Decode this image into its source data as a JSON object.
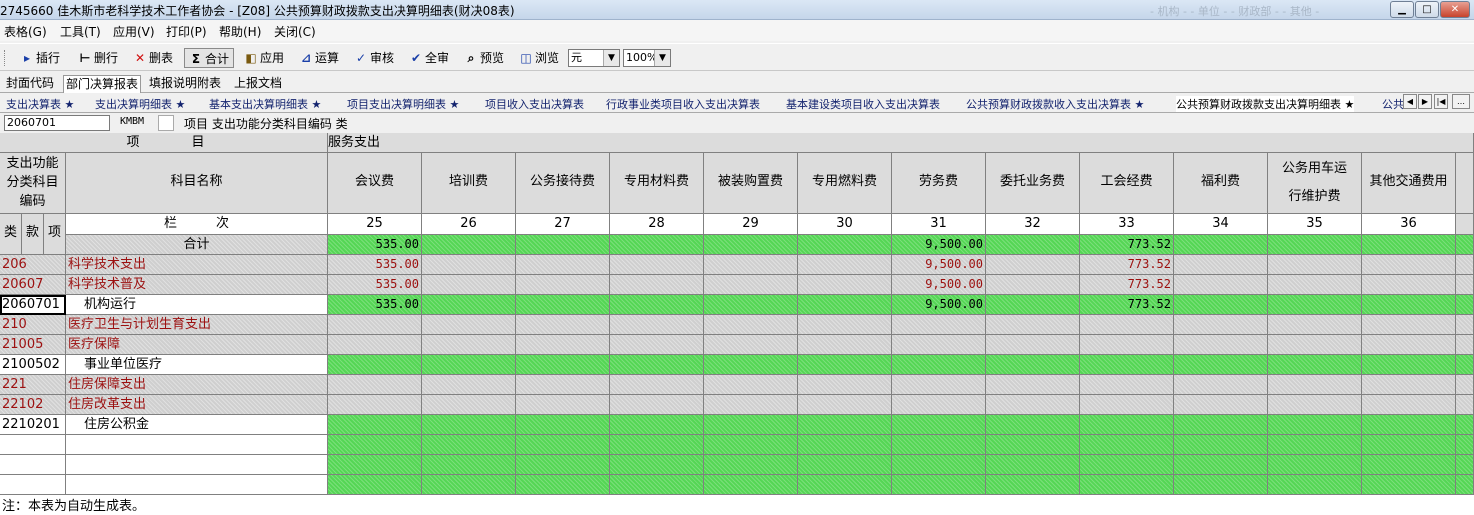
{
  "window": {
    "title": "2745660  佳木斯市老科学技术工作者协会 - [Z08] 公共预算财政拨款支出决算明细表(财决08表)",
    "blurred_text": "- 机构 -     - 单位 -    - 财政部 -    - 其他 -"
  },
  "menu": [
    "表格(G)",
    "工具(T)",
    "应用(V)",
    "打印(P)",
    "帮助(H)",
    "关闭(C)"
  ],
  "toolbar": {
    "insert_row": "插行",
    "delete_row": "删行",
    "delete_table": "删表",
    "total": "合计",
    "apply": "应用",
    "calculate": "运算",
    "audit": "审核",
    "audit_all": "全审",
    "preview": "预览",
    "browse": "浏览",
    "unit_value": "元",
    "zoom_value": "100%"
  },
  "tabs_main": [
    "封面代码",
    "部门决算报表",
    "填报说明附表",
    "上报文档"
  ],
  "tabs_sub": [
    "支出决算表 ★",
    "支出决算明细表 ★",
    "基本支出决算明细表 ★",
    "项目支出决算明细表 ★",
    "项目收入支出决算表",
    "行政事业类项目收入支出决算表",
    "基本建设类项目收入支出决算表",
    "公共预算财政拨款收入支出决算表 ★",
    "公共预算财政拨款支出决算明细表 ★",
    "公共"
  ],
  "input_bar": {
    "code_value": "2060701",
    "field_code": "KMBM",
    "hint": "项目  支出功能分类科目编码 类"
  },
  "table": {
    "header_project": "项　　　　目",
    "header_group": "服务支出",
    "header_code": "支出功能分类科目编码",
    "header_name": "科目名称",
    "header_lanci": "栏　　　次",
    "sub_headers": [
      "类",
      "款",
      "项"
    ],
    "columns": [
      {
        "name": "会议费",
        "no": "25"
      },
      {
        "name": "培训费",
        "no": "26"
      },
      {
        "name": "公务接待费",
        "no": "27"
      },
      {
        "name": "专用材料费",
        "no": "28"
      },
      {
        "name": "被装购置费",
        "no": "29"
      },
      {
        "name": "专用燃料费",
        "no": "30"
      },
      {
        "name": "劳务费",
        "no": "31"
      },
      {
        "name": "委托业务费",
        "no": "32"
      },
      {
        "name": "工会经费",
        "no": "33"
      },
      {
        "name": "福利费",
        "no": "34"
      },
      {
        "name": "公务用车运行维护费",
        "no": "35"
      },
      {
        "name": "其他交通费用",
        "no": "36"
      }
    ],
    "rows": [
      {
        "code": "",
        "name": "合计",
        "kind": "total",
        "values": [
          "535.00",
          "",
          "",
          "",
          "",
          "",
          "9,500.00",
          "",
          "773.52",
          "",
          "",
          ""
        ]
      },
      {
        "code": "206",
        "name": "科学技术支出",
        "kind": "category",
        "values": [
          "535.00",
          "",
          "",
          "",
          "",
          "",
          "9,500.00",
          "",
          "773.52",
          "",
          "",
          ""
        ]
      },
      {
        "code": "20607",
        "name": "科学技术普及",
        "kind": "category",
        "values": [
          "535.00",
          "",
          "",
          "",
          "",
          "",
          "9,500.00",
          "",
          "773.52",
          "",
          "",
          ""
        ]
      },
      {
        "code": "2060701",
        "name": "机构运行",
        "kind": "item",
        "values": [
          "535.00",
          "",
          "",
          "",
          "",
          "",
          "9,500.00",
          "",
          "773.52",
          "",
          "",
          ""
        ]
      },
      {
        "code": "210",
        "name": "医疗卫生与计划生育支出",
        "kind": "category",
        "values": [
          "",
          "",
          "",
          "",
          "",
          "",
          "",
          "",
          "",
          "",
          "",
          ""
        ]
      },
      {
        "code": "21005",
        "name": "医疗保障",
        "kind": "category",
        "values": [
          "",
          "",
          "",
          "",
          "",
          "",
          "",
          "",
          "",
          "",
          "",
          ""
        ]
      },
      {
        "code": "2100502",
        "name": "事业单位医疗",
        "kind": "item",
        "values": [
          "",
          "",
          "",
          "",
          "",
          "",
          "",
          "",
          "",
          "",
          "",
          ""
        ]
      },
      {
        "code": "221",
        "name": "住房保障支出",
        "kind": "category",
        "values": [
          "",
          "",
          "",
          "",
          "",
          "",
          "",
          "",
          "",
          "",
          "",
          ""
        ]
      },
      {
        "code": "22102",
        "name": "住房改革支出",
        "kind": "category",
        "values": [
          "",
          "",
          "",
          "",
          "",
          "",
          "",
          "",
          "",
          "",
          "",
          ""
        ]
      },
      {
        "code": "2210201",
        "name": "住房公积金",
        "kind": "item",
        "values": [
          "",
          "",
          "",
          "",
          "",
          "",
          "",
          "",
          "",
          "",
          "",
          ""
        ]
      },
      {
        "code": "",
        "name": "",
        "kind": "blank",
        "values": [
          "",
          "",
          "",
          "",
          "",
          "",
          "",
          "",
          "",
          "",
          "",
          ""
        ]
      },
      {
        "code": "",
        "name": "",
        "kind": "blank",
        "values": [
          "",
          "",
          "",
          "",
          "",
          "",
          "",
          "",
          "",
          "",
          "",
          ""
        ]
      },
      {
        "code": "",
        "name": "",
        "kind": "blank",
        "values": [
          "",
          "",
          "",
          "",
          "",
          "",
          "",
          "",
          "",
          "",
          "",
          ""
        ]
      }
    ],
    "note": "注：本表为自动生成表。"
  }
}
